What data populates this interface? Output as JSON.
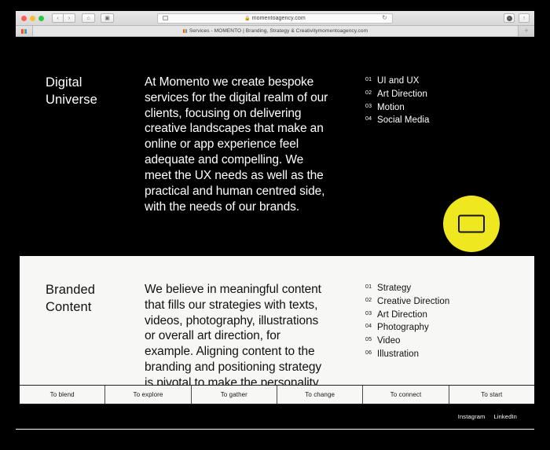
{
  "browser": {
    "traffic_lights": [
      "close",
      "minimize",
      "maximize"
    ],
    "back_label": "‹",
    "forward_label": "›",
    "home_label": "⌂",
    "sidebar_label": "▣",
    "url": "momentoagency.com",
    "lock_icon": "🔒",
    "reload_icon": "↻",
    "downloads_glyph": "↓",
    "share_label": "↑",
    "new_tab_label": "+",
    "tab_title": "Services - MOMENTO | Branding, Strategy & Creativitymomentoagency.com"
  },
  "colors": {
    "dark_bg": "#000000",
    "light_bg": "#f7f7f5",
    "accent_yellow": "#efe820",
    "text_light": "#ffffff",
    "text_dark": "#111111"
  },
  "sections": [
    {
      "title": "Digital\nUniverse",
      "title_line1": "Digital",
      "title_line2": "Universe",
      "body": "At Momento we create bespoke services for the digital realm of our clients, focusing on delivering creative landscapes that make an online or app experience feel adequate and compelling. We meet the UX needs as well as the practical and human centred side, with the needs of our brands.",
      "list": [
        {
          "num": "01",
          "label": "UI and UX"
        },
        {
          "num": "02",
          "label": "Art Direction"
        },
        {
          "num": "03",
          "label": "Motion"
        },
        {
          "num": "04",
          "label": "Social Media"
        }
      ],
      "badge": {
        "icon": "screen-icon",
        "color": "#efe820"
      }
    },
    {
      "title_line1": "Branded",
      "title_line2": "Content",
      "body": "We believe in meaningful content that fills our strategies with texts, videos, photography, illustrations or overall art direction, for example. Aligning content to the branding and positioning strategy is pivotal to make the personality of the brand shine and stand out in an engaging way.",
      "list": [
        {
          "num": "01",
          "label": "Strategy"
        },
        {
          "num": "02",
          "label": "Creative Direction"
        },
        {
          "num": "03",
          "label": "Art Direction"
        },
        {
          "num": "04",
          "label": "Photography"
        },
        {
          "num": "05",
          "label": "Video"
        },
        {
          "num": "06",
          "label": "Illustration"
        }
      ]
    }
  ],
  "footer_nav": [
    {
      "label": "To blend"
    },
    {
      "label": "To explore"
    },
    {
      "label": "To gather"
    },
    {
      "label": "To change"
    },
    {
      "label": "To connect"
    },
    {
      "label": "To start"
    }
  ],
  "social": [
    {
      "label": "Instagram"
    },
    {
      "label": "LinkedIn"
    }
  ]
}
